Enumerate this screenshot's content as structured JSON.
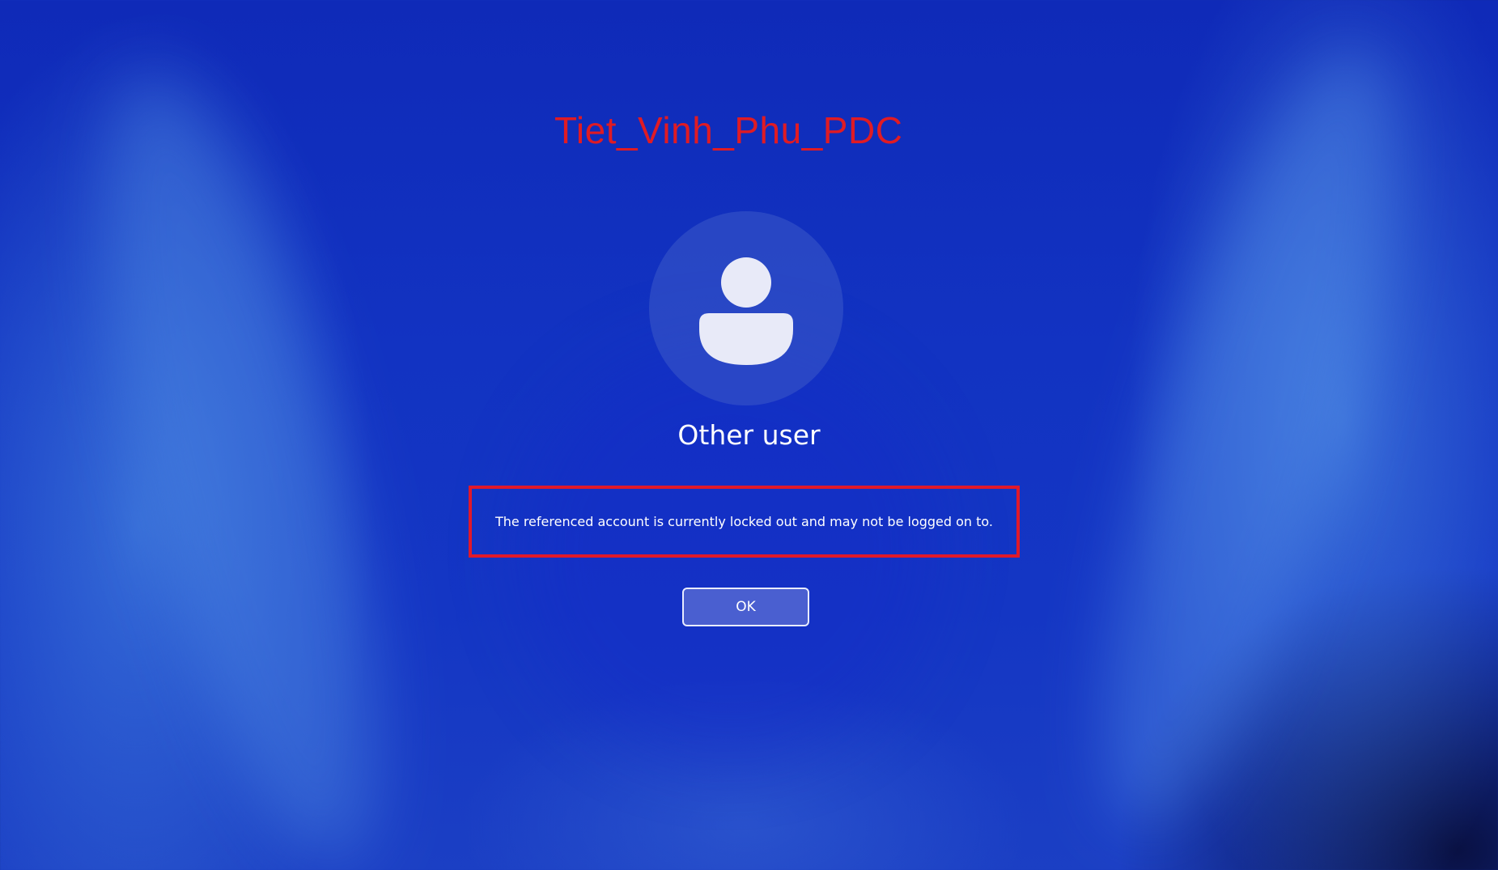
{
  "watermark": {
    "text": "Tiet_Vinh_Phu_PDC"
  },
  "user": {
    "avatar_icon": "person-icon",
    "name": "Other user"
  },
  "message": {
    "text": "The referenced account is currently locked out and may not be logged on to."
  },
  "actions": {
    "ok_label": "OK"
  },
  "colors": {
    "background": "#1233c2",
    "watermark": "#e01b24",
    "message_border": "#e0192a",
    "button_fill": "#4a5fd0",
    "text": "#ffffff"
  }
}
